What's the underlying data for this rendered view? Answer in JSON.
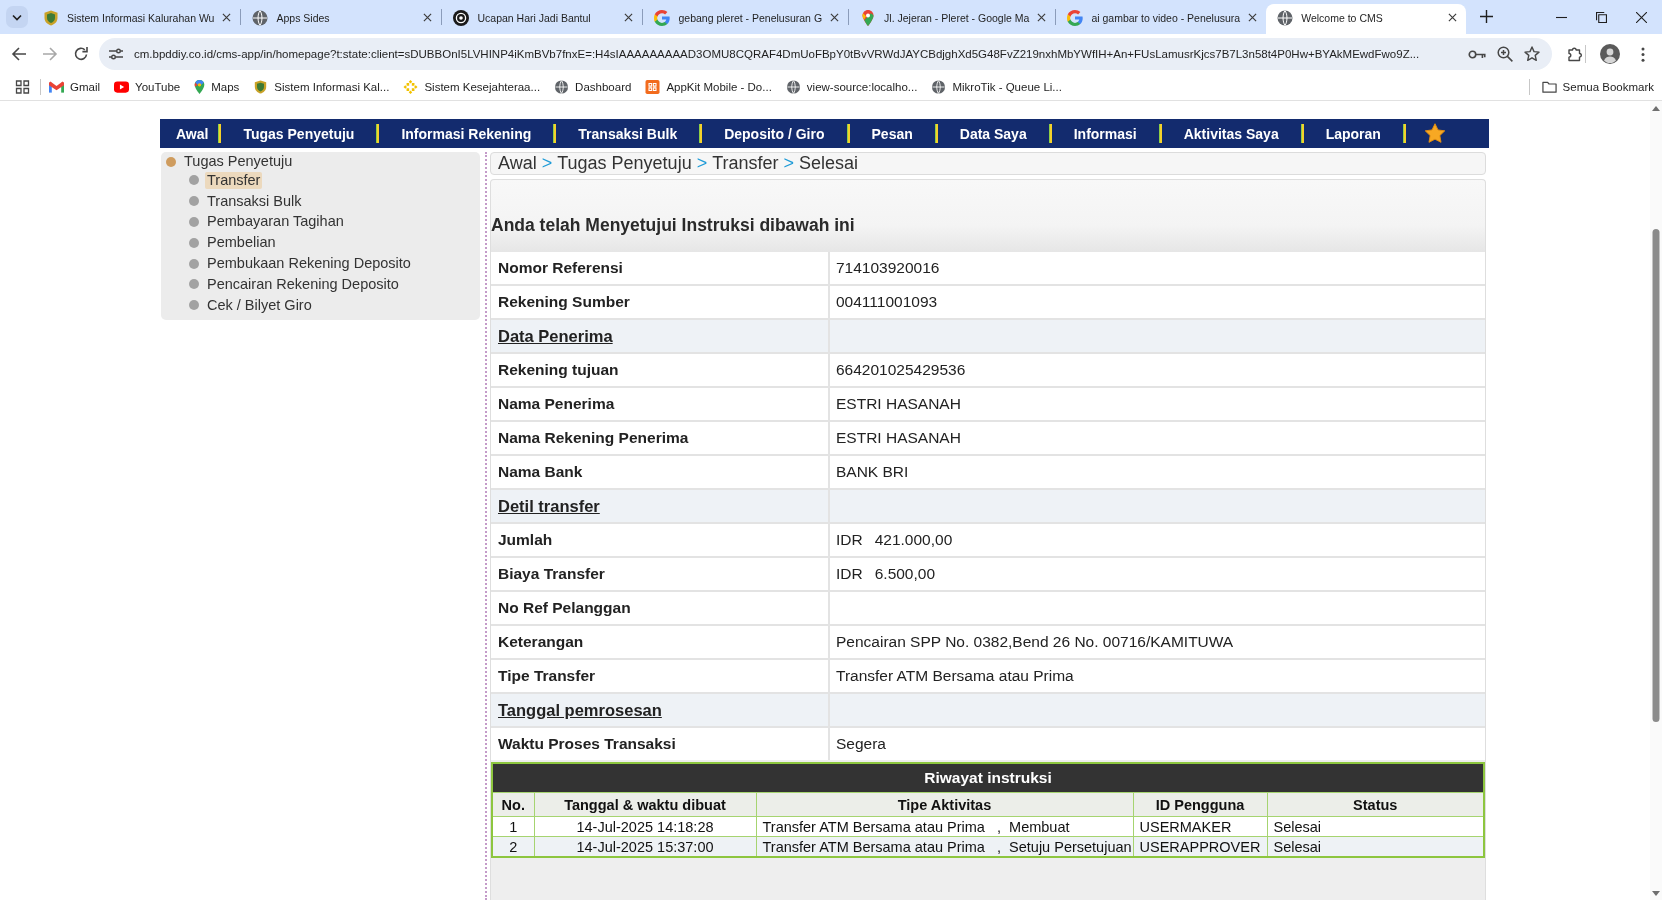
{
  "browser": {
    "tabs": [
      {
        "kind": "crest",
        "title": "Sistem Informasi Kalurahan Wu",
        "selected": false
      },
      {
        "kind": "globe",
        "title": "Apps Sides",
        "selected": false
      },
      {
        "kind": "round-logo",
        "title": "Ucapan Hari Jadi Bantul",
        "selected": false
      },
      {
        "kind": "google",
        "title": "gebang pleret - Penelusuran G",
        "selected": false
      },
      {
        "kind": "maps",
        "title": "Jl. Jejeran - Pleret - Google Ma",
        "selected": false
      },
      {
        "kind": "google",
        "title": "ai gambar to video - Penelusura",
        "selected": false
      },
      {
        "kind": "globe",
        "title": "Welcome to CMS",
        "selected": true
      }
    ],
    "address": "cm.bpddiy.co.id/cms-app/in/homepage?t:state:client=sDUBBOnI5LVHINP4iKmBVb7fnxE=:H4sIAAAAAAAAAD3OMU8CQRAF4DmUoFBpY0tBvVRWdJAYCBdjghXd5G48FvZ219nxhMbYWfIH+An+FUsLamusrKjcs7B7L3n58t4P0Hw+BYAkMEwdFwo9Z...",
    "bookmarks": [
      {
        "kind": "mail",
        "label": "Gmail"
      },
      {
        "kind": "video",
        "label": "YouTube"
      },
      {
        "kind": "maps",
        "label": "Maps"
      },
      {
        "kind": "crest",
        "label": "Sistem Informasi Kal..."
      },
      {
        "kind": "sparkle",
        "label": "Sistem Kesejahteraa..."
      },
      {
        "kind": "globe",
        "label": "Dashboard"
      },
      {
        "kind": "tile",
        "label": "AppKit Mobile - Do..."
      },
      {
        "kind": "globe",
        "label": "view-source:localho..."
      },
      {
        "kind": "globe",
        "label": "MikroTik - Queue Li..."
      }
    ],
    "all_bookmarks": "Semua Bookmark"
  },
  "nav": {
    "items": [
      {
        "label": "Awal"
      },
      {
        "label": "Tugas Penyetuju"
      },
      {
        "label": "Informasi Rekening"
      },
      {
        "label": "Transaksi Bulk"
      },
      {
        "label": "Deposito / Giro"
      },
      {
        "label": "Pesan"
      },
      {
        "label": "Data Saya"
      },
      {
        "label": "Informasi"
      },
      {
        "label": "Aktivitas Saya"
      },
      {
        "label": "Laporan"
      }
    ]
  },
  "sidebar": {
    "items": [
      {
        "label": "Tugas Penyetuju",
        "children": [
          {
            "label": "Transfer",
            "selected": true
          },
          {
            "label": "Transaksi Bulk",
            "selected": false
          },
          {
            "label": "Pembayaran Tagihan",
            "selected": false
          },
          {
            "label": "Pembelian",
            "selected": false
          },
          {
            "label": "Pembukaan Rekening Deposito",
            "selected": false
          },
          {
            "label": "Pencairan Rekening Deposito",
            "selected": false
          },
          {
            "label": "Cek / Bilyet Giro",
            "selected": false
          }
        ]
      }
    ]
  },
  "breadcrumb": [
    {
      "kind": "crumb",
      "text": "Awal"
    },
    {
      "kind": "separator",
      "text": ">"
    },
    {
      "kind": "crumb",
      "text": "Tugas Penyetuju"
    },
    {
      "kind": "separator",
      "text": ">"
    },
    {
      "kind": "crumb",
      "text": "Transfer"
    },
    {
      "kind": "separator",
      "text": ">"
    },
    {
      "kind": "crumb",
      "text": "Selesai"
    }
  ],
  "heading": "Anda telah Menyetujui Instruksi dibawah ini",
  "details": [
    {
      "kind": "field",
      "label": "Nomor Referensi",
      "value": "714103920016"
    },
    {
      "kind": "field",
      "label": "Rekening Sumber",
      "value": "004111001093"
    },
    {
      "kind": "section",
      "label": "Data Penerima"
    },
    {
      "kind": "field",
      "label": "Rekening tujuan",
      "value": "664201025429536"
    },
    {
      "kind": "field",
      "label": "Nama Penerima",
      "value": "ESTRI HASANAH"
    },
    {
      "kind": "field",
      "label": "Nama Rekening Penerima",
      "value": "ESTRI HASANAH"
    },
    {
      "kind": "field",
      "label": "Nama Bank",
      "value": "BANK BRI"
    },
    {
      "kind": "section",
      "label": "Detil transfer"
    },
    {
      "kind": "amount",
      "label": "Jumlah",
      "currency": "IDR",
      "value": "421.000,00"
    },
    {
      "kind": "amount",
      "label": "Biaya Transfer",
      "currency": "IDR",
      "value": "6.500,00"
    },
    {
      "kind": "field",
      "label": "No Ref Pelanggan"
    },
    {
      "kind": "field",
      "label": "Keterangan",
      "value": "Pencairan SPP No. 0382,Bend 26 No. 00716/KAMITUWA"
    },
    {
      "kind": "field",
      "label": "Tipe Transfer",
      "value": "Transfer ATM Bersama atau Prima"
    },
    {
      "kind": "section",
      "label": "Tanggal pemrosesan"
    },
    {
      "kind": "field",
      "label": "Waktu Proses Transaksi",
      "value": "Segera"
    }
  ],
  "history": {
    "title": "Riwayat instruksi",
    "columns": [
      "No.",
      "Tanggal & waktu dibuat",
      "Tipe Aktivitas",
      "ID Pengguna",
      "Status"
    ],
    "rows": [
      {
        "no": "1",
        "created": "14-Jul-2025 14:18:28",
        "activity": "Transfer ATM Bersama atau Prima   ,  Membuat",
        "user": "USERMAKER",
        "status": "Selesai"
      },
      {
        "no": "2",
        "created": "14-Jul-2025 15:37:00",
        "activity": "Transfer ATM Bersama atau Prima   ,  Setuju Persetujuan",
        "user": "USERAPPROVER",
        "status": "Selesai"
      }
    ]
  }
}
